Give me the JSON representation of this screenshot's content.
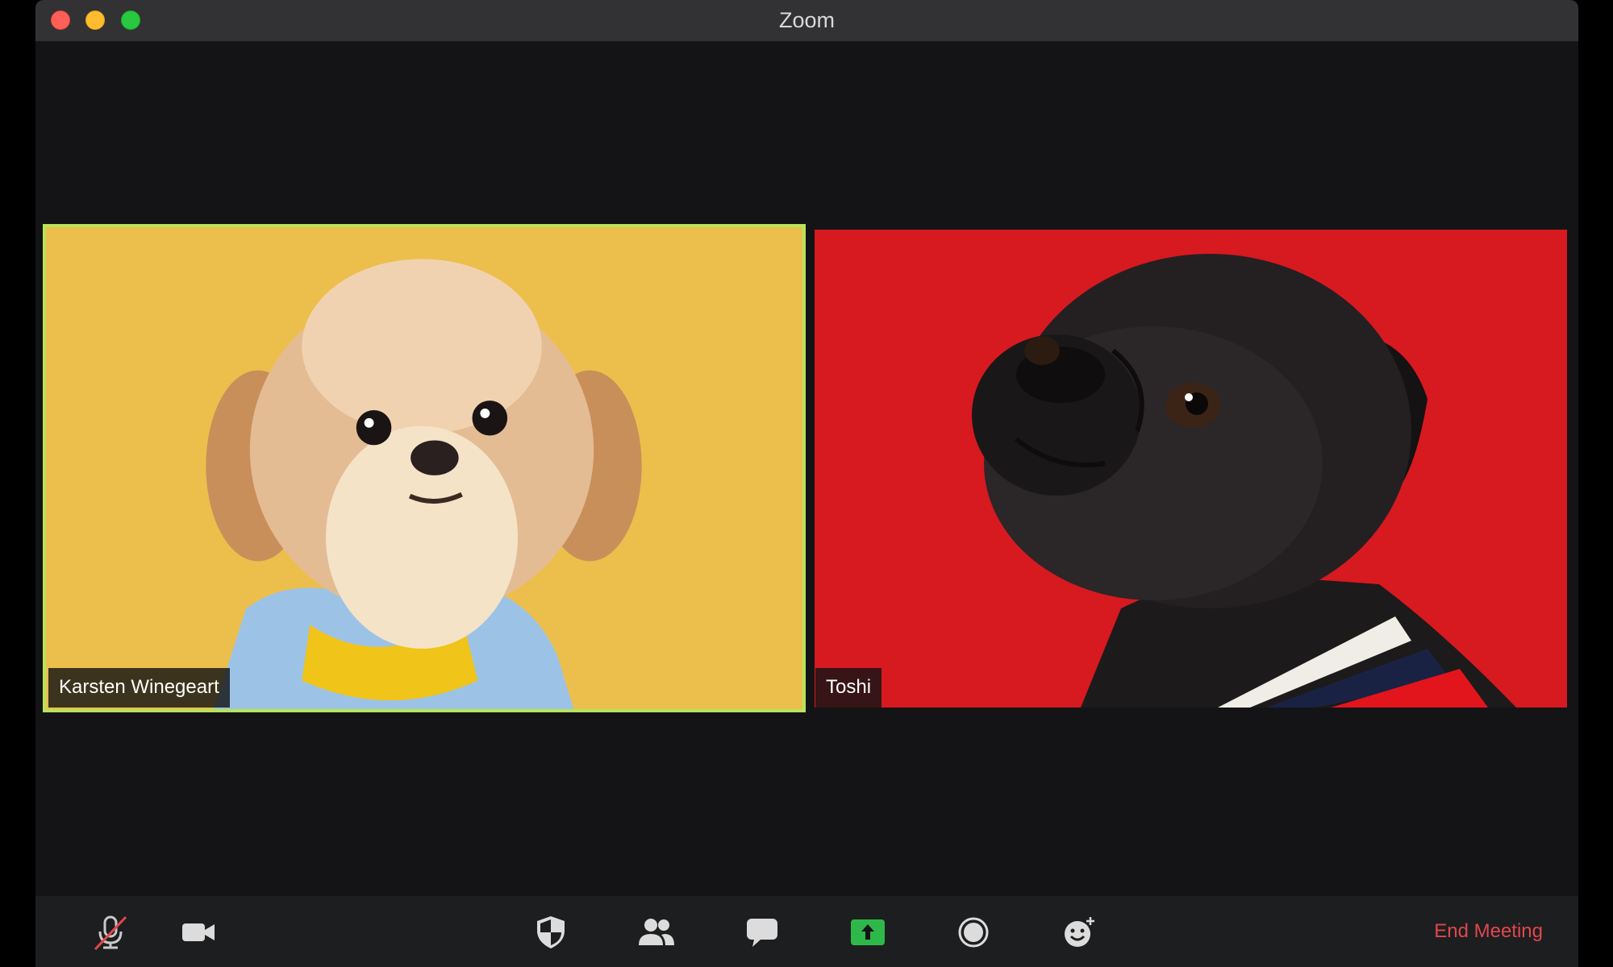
{
  "window": {
    "title": "Zoom"
  },
  "participants": [
    {
      "name": "Karsten Winegeart",
      "active_speaker": true,
      "background_color": "#ecbf4c",
      "highlight_color": "#b9e35a"
    },
    {
      "name": "Toshi",
      "active_speaker": false,
      "background_color": "#d71920"
    }
  ],
  "toolbar": {
    "buttons": [
      {
        "name": "mute",
        "icon": "microphone-muted-icon"
      },
      {
        "name": "video",
        "icon": "video-camera-icon"
      },
      {
        "name": "security",
        "icon": "shield-icon"
      },
      {
        "name": "participants",
        "icon": "people-icon"
      },
      {
        "name": "chat",
        "icon": "chat-bubble-icon"
      },
      {
        "name": "share-screen",
        "icon": "share-screen-icon",
        "color": "#2fb84a"
      },
      {
        "name": "record",
        "icon": "record-icon"
      },
      {
        "name": "reactions",
        "icon": "emoji-add-icon"
      }
    ],
    "end_meeting_label": "End Meeting",
    "end_meeting_color": "#e0474c"
  }
}
